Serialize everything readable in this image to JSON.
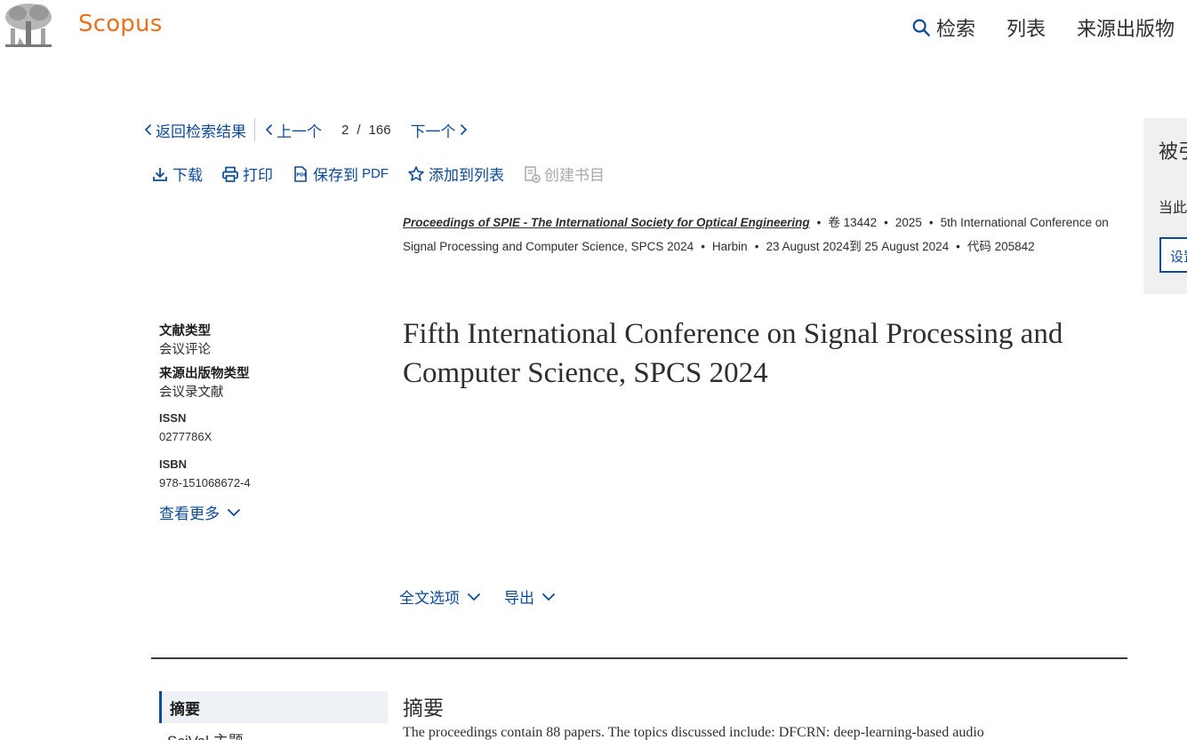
{
  "header": {
    "brand": "Scopus",
    "nav": [
      {
        "label": "检索",
        "icon": "search-icon"
      },
      {
        "label": "列表"
      },
      {
        "label": "来源出版物"
      }
    ]
  },
  "pager": {
    "back_label": "返回检索结果",
    "prev_label": "上一个",
    "current": "2",
    "slash": "/",
    "total": "166",
    "next_label": "下一个"
  },
  "actions": {
    "download": "下载",
    "print": "打印",
    "save_pdf": "保存到",
    "save_pdf_suffix": "PDF",
    "add_list": "添加到列表",
    "create_bib": "创建书目"
  },
  "source": {
    "journal": "Proceedings of SPIE - The International Society for Optical Engineering",
    "volume": "卷 13442",
    "year": "2025",
    "conference": "5th International Conference on Signal Processing and Computer Science, SPCS 2024",
    "location": "Harbin",
    "dates": "23 August 2024到 25 August 2024",
    "code": "代码 205842"
  },
  "meta": {
    "doc_type_label": "文献类型",
    "doc_type": "会议评论",
    "source_type_label": "来源出版物类型",
    "source_type": "会议录文献",
    "issn_label": "ISSN",
    "issn": "0277786X",
    "isbn_label": "ISBN",
    "isbn": "978-151068672-4",
    "see_more": "查看更多"
  },
  "title": "Fifth International Conference on Signal Processing and Computer Science, SPCS 2024",
  "options": {
    "fulltext": "全文选项",
    "export": "导出"
  },
  "section_nav": {
    "abstract": "摘要",
    "scival": "SciVal 主题"
  },
  "abstract": {
    "heading": "摘要",
    "text": "The proceedings contain 88 papers. The topics discussed include: DFCRN: deep-learning-based audio"
  },
  "side_panel": {
    "title": "被引",
    "text": "当此文献",
    "button": "设置"
  },
  "colors": {
    "brand": "#e9711c",
    "link": "#0c4a9a"
  }
}
